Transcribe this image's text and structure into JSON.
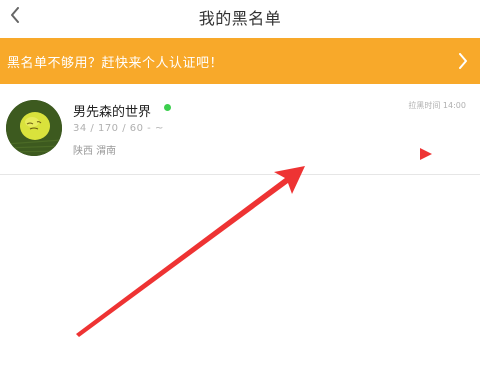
{
  "nav": {
    "title": "我的黑名单",
    "back_icon": "chevron-left-icon"
  },
  "banner": {
    "text": "黑名单不够用？赶快来个人认证吧！",
    "chevron_icon": "chevron-right-icon",
    "background": "#f8a92a"
  },
  "blocked_list": [
    {
      "nickname": "男先森的世界",
      "online": true,
      "stats": "34 / 170 / 60 - ~",
      "location": "陕西 渭南",
      "block_time": "拉黑时间 14:00"
    }
  ],
  "colors": {
    "online_dot": "#3ccf4e",
    "annotation": "#ee3333"
  }
}
